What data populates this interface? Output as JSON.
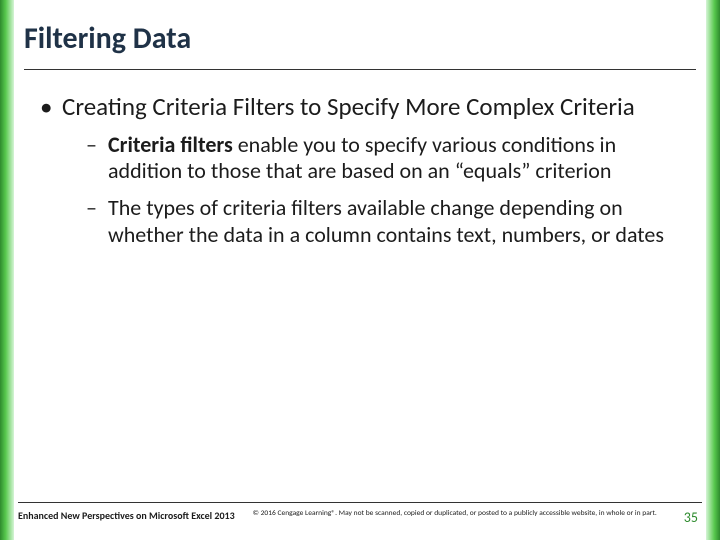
{
  "colors": {
    "accent_green": "#2e8b2e",
    "title_color": "#1f3247",
    "text_color": "#1c1c1c"
  },
  "slide": {
    "title": "Filtering Data",
    "bullets": {
      "l1": "Creating Criteria Filters to Specify More Complex Criteria",
      "l2a_bold": "Criteria filters",
      "l2a_rest": " enable you to specify various conditions in addition to those that are based on an “equals” criterion",
      "l2b": "The types of criteria filters available change depending on whether the data in a column contains text, numbers, or dates"
    }
  },
  "footer": {
    "left": "Enhanced New Perspectives on Microsoft Excel 2013",
    "center": "© 2016 Cengage Learning®. May not be scanned, copied or duplicated, or posted to a publicly accessible website, in whole or in part.",
    "page": "35"
  }
}
